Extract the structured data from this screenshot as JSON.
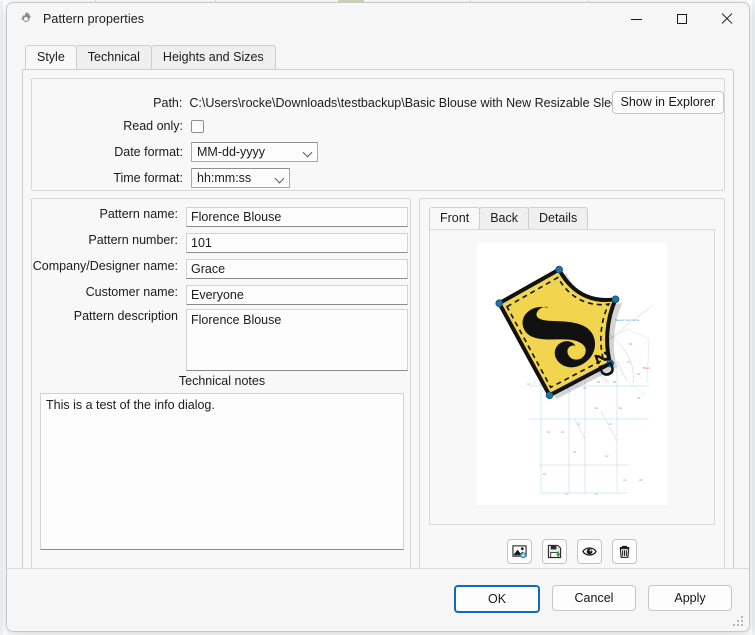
{
  "window": {
    "title": "Pattern properties",
    "icon": "gear-icon",
    "minimize_label": "Minimize",
    "maximize_label": "Maximize",
    "close_label": "Close"
  },
  "tabs": [
    {
      "label": "Style",
      "active": true
    },
    {
      "label": "Technical",
      "active": false
    },
    {
      "label": "Heights and Sizes",
      "active": false
    }
  ],
  "file_info": {
    "path_label": "Path:",
    "path_value": "C:\\Users\\rocke\\Downloads\\testbackup\\Basic Blouse with New Resizable Sleeve - Bev - B.v",
    "show_in_explorer_label": "Show in Explorer",
    "read_only_label": "Read only:",
    "read_only_checked": false,
    "date_format_label": "Date format:",
    "date_format_value": "MM-dd-yyyy",
    "time_format_label": "Time format:",
    "time_format_value": "hh:mm:ss"
  },
  "form": {
    "pattern_name_label": "Pattern name:",
    "pattern_name_value": "Florence Blouse",
    "pattern_number_label": "Pattern number:",
    "pattern_number_value": "101",
    "company_label": "Company/Designer name:",
    "company_value": "Grace",
    "customer_label": "Customer name:",
    "customer_value": "Everyone",
    "description_label": "Pattern description",
    "description_value": "Florence Blouse",
    "technical_notes_label": "Technical notes",
    "technical_notes_value": "This is a test of the info dialog."
  },
  "image_panel": {
    "tabs": [
      {
        "label": "Front",
        "active": true
      },
      {
        "label": "Back",
        "active": false
      },
      {
        "label": "Details",
        "active": false
      }
    ],
    "preview_alt": "Seamly2D logo over pattern draft",
    "toolbar": [
      {
        "name": "add-image-icon",
        "label": "Add image"
      },
      {
        "name": "save-image-icon",
        "label": "Save image"
      },
      {
        "name": "show-image-icon",
        "label": "Show image"
      },
      {
        "name": "delete-image-icon",
        "label": "Delete image"
      }
    ]
  },
  "footer": {
    "ok_label": "OK",
    "cancel_label": "Cancel",
    "apply_label": "Apply"
  },
  "colors": {
    "accent": "#0f6cbd",
    "logo_yellow": "#f2d54e",
    "window_bg": "#f6f6f6",
    "panel_bg": "#f8f8f8",
    "field_bg": "#fdfdfd"
  }
}
